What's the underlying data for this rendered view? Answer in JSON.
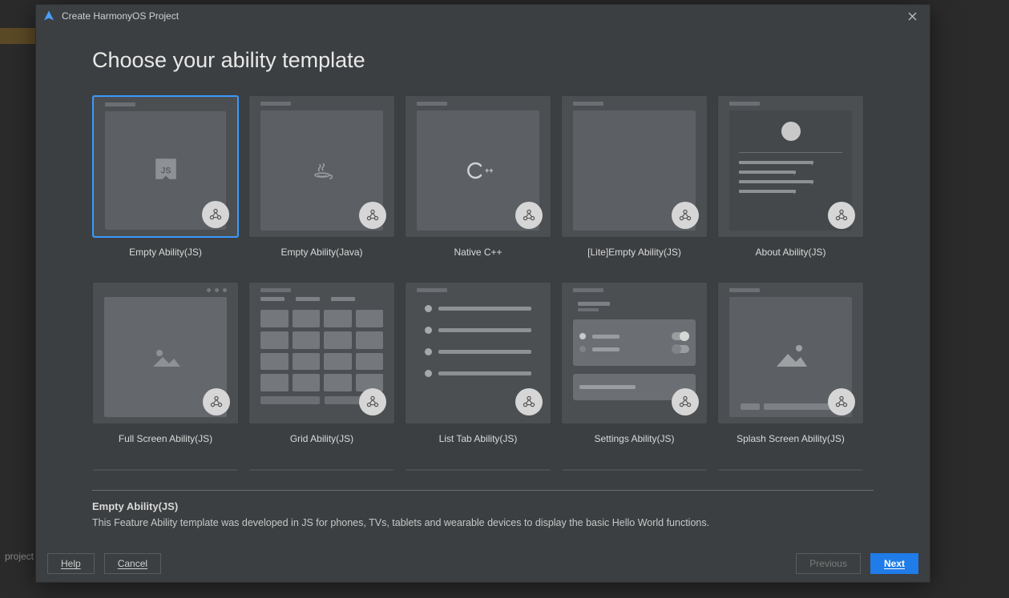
{
  "background": {
    "project_label": "project"
  },
  "dialog": {
    "title": "Create HarmonyOS Project",
    "heading": "Choose your ability template"
  },
  "templates": [
    {
      "label": "Empty Ability(JS)",
      "selected": true
    },
    {
      "label": "Empty Ability(Java)"
    },
    {
      "label": "Native C++"
    },
    {
      "label": "[Lite]Empty Ability(JS)"
    },
    {
      "label": "About Ability(JS)"
    },
    {
      "label": "Full Screen Ability(JS)"
    },
    {
      "label": "Grid Ability(JS)"
    },
    {
      "label": "List Tab Ability(JS)"
    },
    {
      "label": "Settings Ability(JS)"
    },
    {
      "label": "Splash Screen Ability(JS)"
    }
  ],
  "detail": {
    "title": "Empty Ability(JS)",
    "description": "This Feature Ability template was developed in JS for phones, TVs, tablets and wearable devices to display the basic Hello World functions."
  },
  "footer": {
    "help": "Help",
    "cancel": "Cancel",
    "previous": "Previous",
    "next": "Next"
  },
  "colors": {
    "dialog_bg": "#3c3f41",
    "selection": "#3b99fc",
    "primary_button": "#1f7ce8"
  }
}
